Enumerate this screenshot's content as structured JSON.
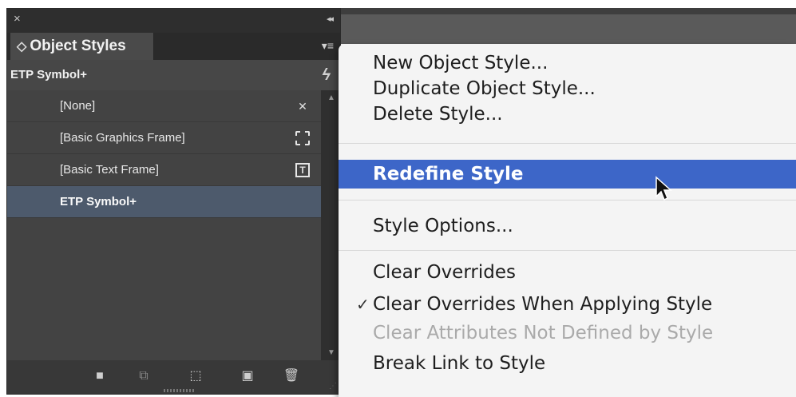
{
  "panel": {
    "close_glyph": "×",
    "collapse_glyph": "◂◂",
    "tab_chevron": "◇",
    "tab_title": "Object Styles",
    "menu_glyph": "▾≡",
    "group_name": "ETP Symbol+",
    "styles": [
      {
        "label": "[None]",
        "icon": "no-frame-icon",
        "selected": false
      },
      {
        "label": "[Basic Graphics Frame]",
        "icon": "graphics-frame-icon",
        "selected": false
      },
      {
        "label": "[Basic Text Frame]",
        "icon": "text-frame-icon",
        "selected": false
      },
      {
        "label": "ETP Symbol+",
        "icon": "",
        "selected": true
      }
    ],
    "bottom_icons": [
      "folder-icon",
      "link-style-icon",
      "clear-overrides-icon",
      "new-style-icon",
      "trash-icon"
    ]
  },
  "menu": {
    "items": [
      {
        "label": "New Object Style..."
      },
      {
        "label": "Duplicate Object Style..."
      },
      {
        "label": "Delete Style..."
      },
      {
        "label": "Redefine Style",
        "highlighted": true
      },
      {
        "label": "Style Options..."
      },
      {
        "label": "Clear Overrides"
      },
      {
        "label": "Clear Overrides When Applying Style",
        "checked": true
      },
      {
        "label": "Clear Attributes Not Defined by Style",
        "disabled": true
      },
      {
        "label": "Break Link to Style"
      }
    ],
    "check_glyph": "✓"
  },
  "colors": {
    "panel_bg": "#3d3d3d",
    "selected_row": "#4d5a6c",
    "menu_highlight": "#3d66c8",
    "menu_bg": "#f4f4f4"
  }
}
